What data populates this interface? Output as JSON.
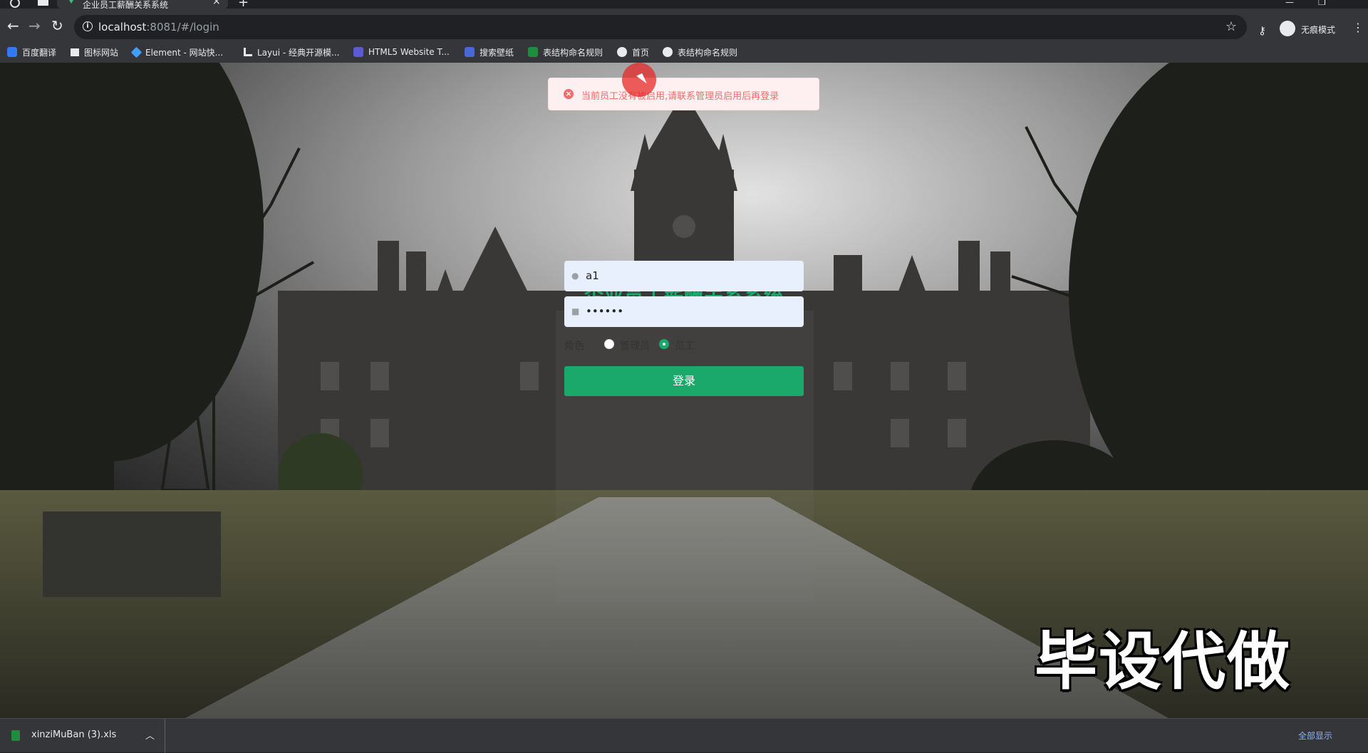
{
  "browser": {
    "tab": {
      "title": "企业员工薪酬关系系统",
      "close": "×"
    },
    "new_tab": "+",
    "url": {
      "host": "localhost",
      "path": ":8081/#/login"
    },
    "profile_label": "无痕模式",
    "bookmarks": [
      {
        "label": "百度翻译",
        "color": "#2d7cf6"
      },
      {
        "label": "图标网站",
        "color": "#e8eaed"
      },
      {
        "label": "Element - 网站快...",
        "color": "#409eff"
      },
      {
        "label": "Layui - 经典开源模...",
        "color": "#e8eaed"
      },
      {
        "label": "HTML5 Website T...",
        "color": "#5b5bd6"
      },
      {
        "label": "搜索壁纸",
        "color": "#4a67d6"
      },
      {
        "label": "表结构命名规则",
        "color": "#1e8e3e"
      },
      {
        "label": "首页",
        "color": "#e8eaed"
      },
      {
        "label": "表结构命名规则",
        "color": "#e8eaed"
      }
    ]
  },
  "alert": {
    "message": "当前员工没有被启用,请联系管理员启用后再登录",
    "color": "#f56c6c"
  },
  "login": {
    "title": "企业员工薪酬关系系统",
    "username_value": "a1",
    "password_value": "••••••",
    "role_label": "角色",
    "roles": [
      {
        "label": "管理员",
        "checked": false
      },
      {
        "label": "员工",
        "checked": true
      }
    ],
    "submit_label": "登录",
    "accent_color": "#1aa96b"
  },
  "watermark": "毕设代做",
  "downloads": {
    "file_name": "xinziMuBan (3).xls",
    "show_all_label": "全部显示"
  }
}
